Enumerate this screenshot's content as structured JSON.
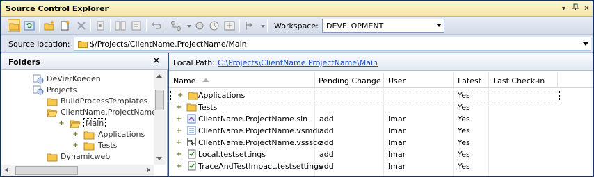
{
  "window": {
    "title": "Source Control Explorer",
    "pin_glyph": "▾",
    "close_glyph": "✕"
  },
  "toolbar": {
    "workspace_label": "Workspace:",
    "workspace_value": "DEVELOPMENT"
  },
  "source_location": {
    "label": "Source location:",
    "value": "$/Projects/ClientName.ProjectName/Main"
  },
  "folders": {
    "header": "Folders",
    "close_glyph": "✕",
    "tree": [
      {
        "label": "DeVierKoeden",
        "icon": "team-project-icon"
      },
      {
        "label": "Projects",
        "icon": "team-project-icon"
      },
      {
        "label": "BuildProcessTemplates",
        "icon": "folder-icon"
      },
      {
        "label": "ClientName.ProjectName",
        "icon": "folder-open-icon"
      },
      {
        "label": "Main",
        "icon": "folder-open-icon"
      },
      {
        "label": "Applications",
        "icon": "folder-icon"
      },
      {
        "label": "Tests",
        "icon": "folder-icon"
      },
      {
        "label": "Dynamicweb",
        "icon": "folder-icon"
      }
    ]
  },
  "details": {
    "local_path_label": "Local Path:",
    "local_path_value": "C:\\Projects\\ClientName.ProjectName\\Main",
    "columns": [
      "Name",
      "Pending Change",
      "User",
      "Latest",
      "Last Check-in"
    ],
    "rows": [
      {
        "name": "Applications",
        "pending": "",
        "user": "",
        "latest": "Yes",
        "checkin": "",
        "icon": "folder-icon"
      },
      {
        "name": "Tests",
        "pending": "",
        "user": "",
        "latest": "Yes",
        "checkin": "",
        "icon": "folder-icon"
      },
      {
        "name": "ClientName.ProjectName.sln",
        "pending": "add",
        "user": "Imar",
        "latest": "Yes",
        "checkin": "",
        "icon": "solution-icon"
      },
      {
        "name": "ClientName.ProjectName.vsmdi",
        "pending": "add",
        "user": "Imar",
        "latest": "Yes",
        "checkin": "",
        "icon": "test-list-icon"
      },
      {
        "name": "ClientName.ProjectName.vssscc",
        "pending": "add",
        "user": "Imar",
        "latest": "Yes",
        "checkin": "",
        "icon": "source-control-file-icon"
      },
      {
        "name": "Local.testsettings",
        "pending": "add",
        "user": "Imar",
        "latest": "Yes",
        "checkin": "",
        "icon": "testsettings-icon"
      },
      {
        "name": "TraceAndTestImpact.testsettings",
        "pending": "add",
        "user": "Imar",
        "latest": "Yes",
        "checkin": "",
        "icon": "testsettings-icon"
      }
    ]
  }
}
